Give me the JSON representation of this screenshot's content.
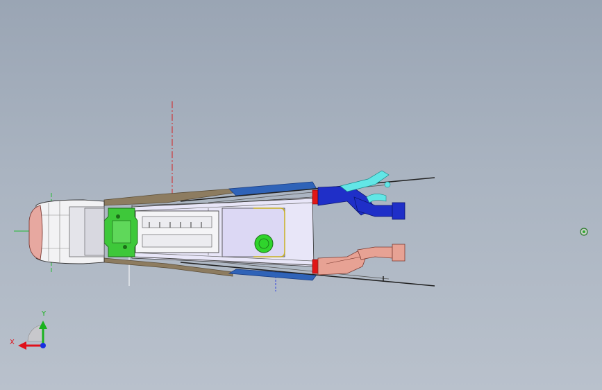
{
  "viewport": {
    "background_top": "#9aa5b4",
    "background_bottom": "#b9c1cc"
  },
  "triad": {
    "x_label": "X",
    "y_label": "Y",
    "x_color": "#e0101a",
    "y_color": "#19b21e",
    "z_color": "#1830e0"
  },
  "model": {
    "part_colors": {
      "front_cap": "#e7a8a0",
      "cab": "#f2f2f4",
      "engine_block": "#3ec83a",
      "body_floor": "#e8e6f8",
      "cowl_bronze": "#8d7c60",
      "fender_blue": "#2f63b8",
      "actuator_blue": "#1f2fc8",
      "actuator_cyan": "#62e6e6",
      "actuator_pink": "#e7a294",
      "wheel_green": "#2fd42c",
      "accent_red": "#e01616"
    }
  },
  "origin_marker": {
    "icon": "target-icon",
    "color": "#33aa33"
  }
}
